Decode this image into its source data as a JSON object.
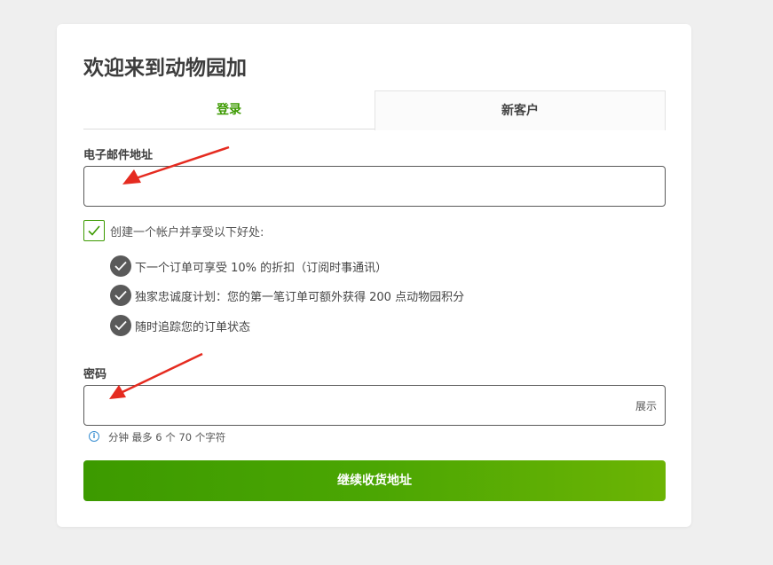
{
  "page": {
    "title": "欢迎来到动物园加"
  },
  "tabs": [
    {
      "label": "登录",
      "active": false
    },
    {
      "label": "新客户",
      "active": true
    }
  ],
  "email": {
    "label": "电子邮件地址",
    "value": "",
    "placeholder": ""
  },
  "create_account": {
    "checked": true,
    "label": "创建一个帐户并享受以下好处:"
  },
  "benefits": [
    {
      "text": "下一个订单可享受 10% 的折扣（订阅时事通讯）",
      "icon": "check-circle-icon"
    },
    {
      "text": "独家忠诚度计划：您的第一笔订单可额外获得 200 点动物园积分",
      "icon": "check-circle-icon"
    },
    {
      "text": "随时追踪您的订单状态",
      "icon": "check-circle-icon"
    }
  ],
  "password": {
    "label": "密码",
    "value": "",
    "show_label": "展示",
    "hint": "分钟 最多 6 个 70 个字符",
    "hint_icon": "info-icon"
  },
  "submit": {
    "label": "继续收货地址"
  },
  "colors": {
    "accent": "#3c9a00",
    "button_end": "#6cb404",
    "annotation_arrow": "#e52b20",
    "info": "#3a8fd1"
  }
}
